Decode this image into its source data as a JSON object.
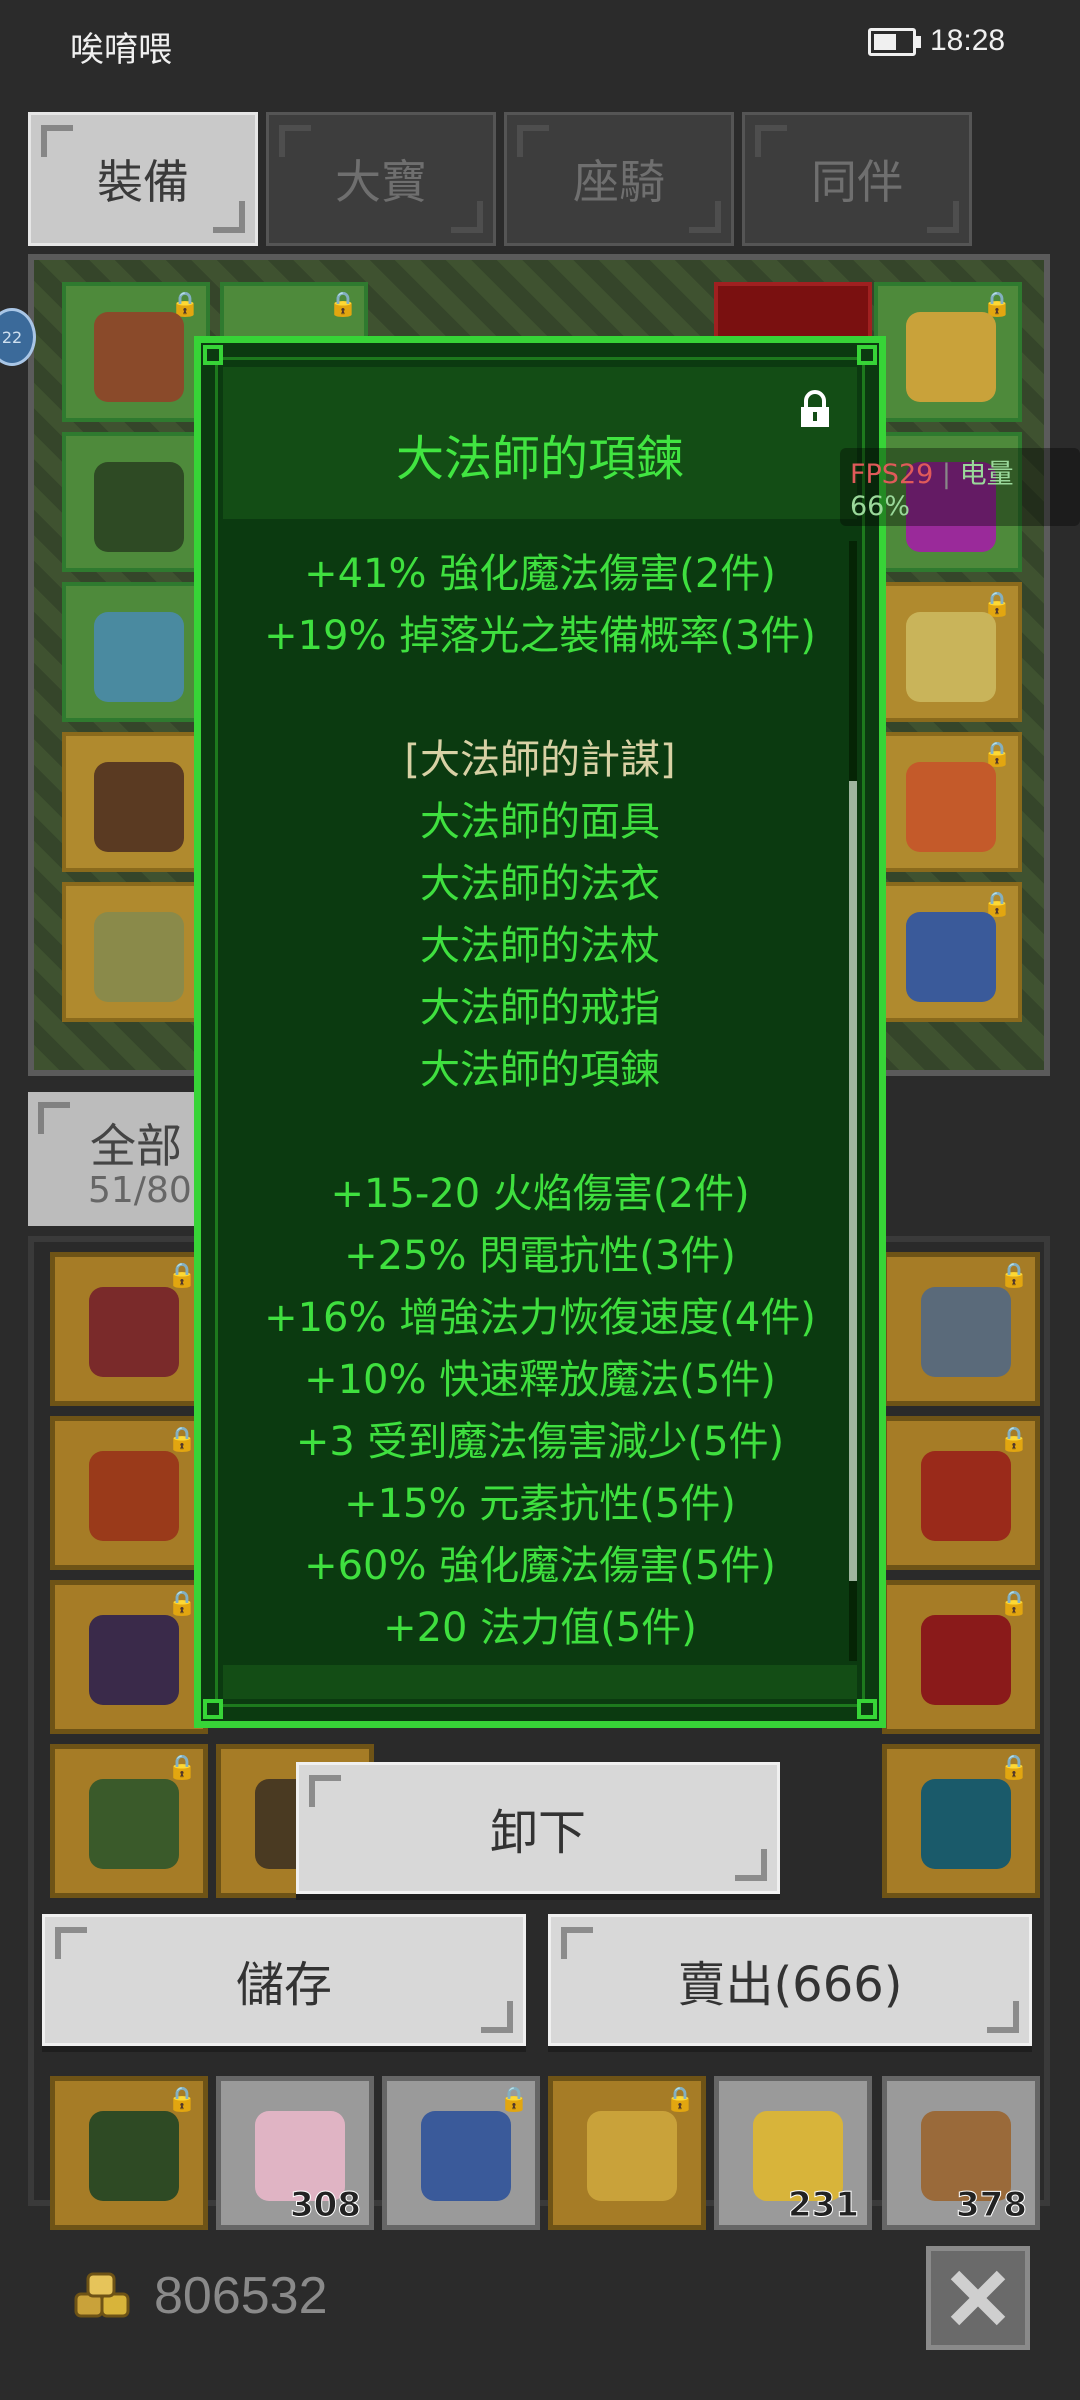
{
  "status_bar": {
    "title": "唉唷喂",
    "time": "18:28"
  },
  "tabs": [
    {
      "label": "裝備",
      "active": true
    },
    {
      "label": "大寶",
      "active": false
    },
    {
      "label": "座騎",
      "active": false
    },
    {
      "label": "同伴",
      "active": false
    }
  ],
  "side_badge": "22",
  "filter": {
    "label": "全部",
    "count": "51/80"
  },
  "tooltip": {
    "title": "大法師的項鍊",
    "lines": [
      "+41% 強化魔法傷害(2件)",
      "+19% 掉落光之裝備概率(3件)",
      "",
      "[大法師的計謀]",
      "大法師的面具",
      "大法師的法衣",
      "大法師的法杖",
      "大法師的戒指",
      "大法師的項鍊",
      "",
      "+15-20 火焰傷害(2件)",
      "+25% 閃電抗性(3件)",
      "+16% 增強法力恢復速度(4件)",
      "+10% 快速釋放魔法(5件)",
      "+3 受到魔法傷害減少(5件)",
      "+15% 元素抗性(5件)",
      "+60% 強化魔法傷害(5件)",
      "+20 法力值(5件)"
    ]
  },
  "overlay": {
    "fps": "FPS29",
    "battery": "电量66%"
  },
  "buttons": {
    "unequip": "卸下",
    "store": "儲存",
    "sell": "賣出(666)"
  },
  "inventory_counts": [
    "308",
    "231",
    "378"
  ],
  "gold": {
    "amount": "806532"
  },
  "colors": {
    "tooltip_border": "#37d437",
    "tooltip_text": "#3fe03f",
    "set_name": "#d8d1a5"
  }
}
